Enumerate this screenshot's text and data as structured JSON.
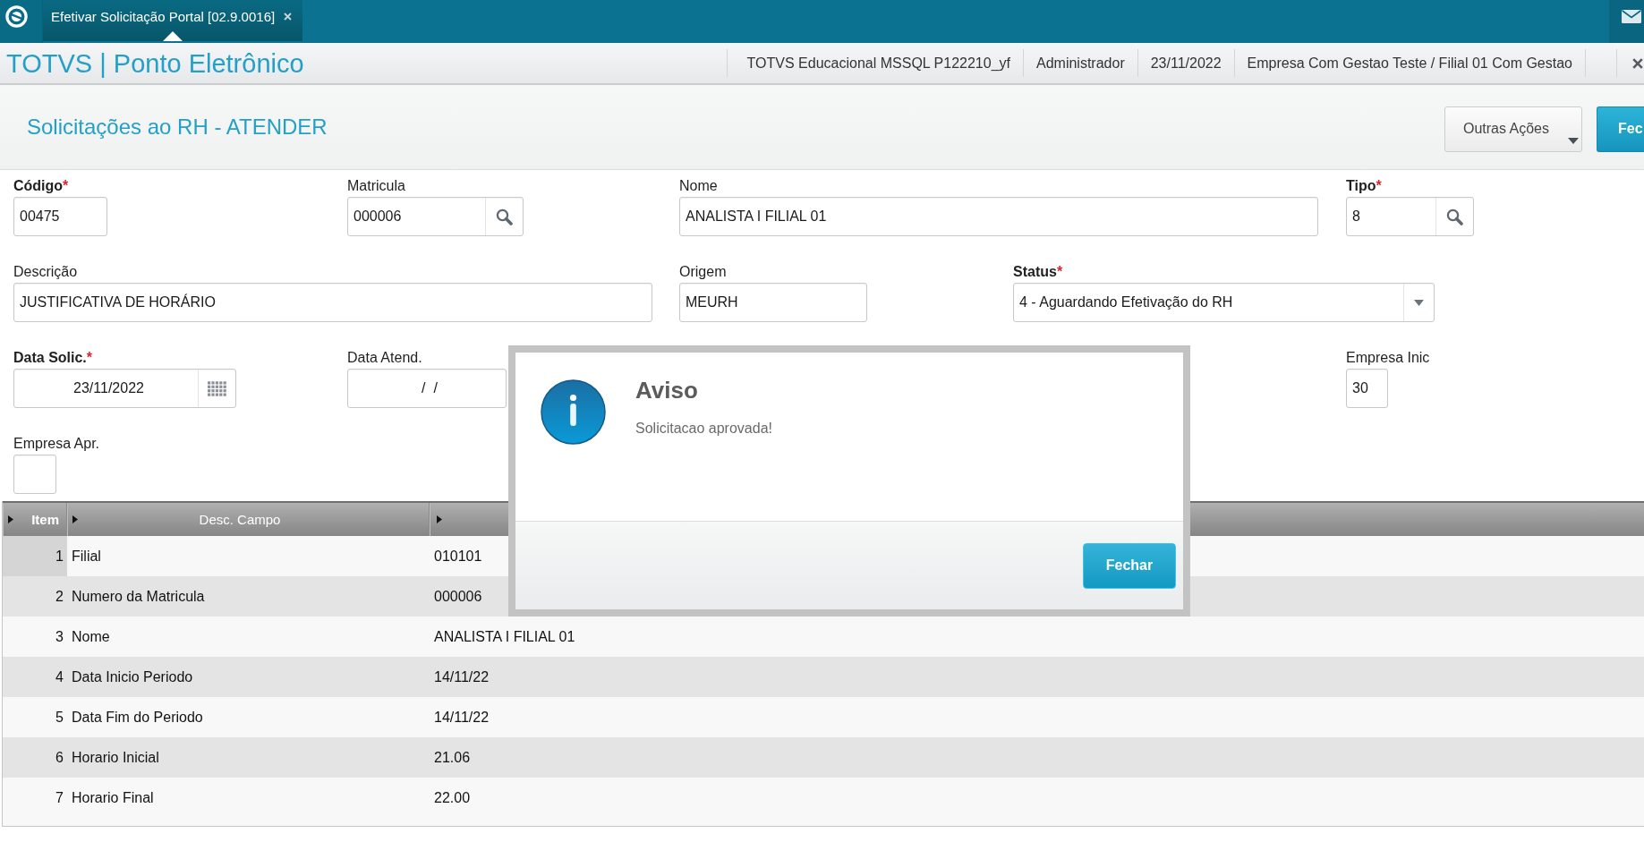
{
  "window": {
    "tabs": [
      {
        "label": "Efetivar Solicitação Portal [02.9.0016]",
        "selected": true
      }
    ]
  },
  "app_header": {
    "title": "TOTVS | Ponto Eletrônico",
    "info": [
      "TOTVS Educacional MSSQL P122210_yf",
      "Administrador",
      "23/11/2022",
      "Empresa Com Gestao Teste / Filial 01 Com Gestao"
    ]
  },
  "page": {
    "title": "Solicitações ao RH - ATENDER",
    "actions": [
      {
        "label": "Outras Ações",
        "kind": "menu"
      },
      {
        "label": "Fec",
        "kind": "primary"
      }
    ]
  },
  "form": {
    "fields": [
      {
        "label": "Código",
        "required": true,
        "required_mark": "*",
        "kind": "text",
        "value": "00475"
      },
      {
        "label": "Matricula",
        "required": false,
        "kind": "lookup",
        "value": "000006"
      },
      {
        "label": "Nome",
        "required": false,
        "kind": "text",
        "value": "ANALISTA I FILIAL 01"
      },
      {
        "label": "Tipo",
        "required": true,
        "required_mark": "*",
        "kind": "lookup",
        "value": "8"
      },
      {
        "label": "Descrição",
        "required": false,
        "kind": "text",
        "value": "JUSTIFICATIVA DE HORÁRIO"
      },
      {
        "label": "Origem",
        "required": false,
        "kind": "text",
        "value": "MEURH"
      },
      {
        "label": "Status",
        "required": true,
        "required_mark": "*",
        "kind": "select",
        "value": "4 - Aguardando Efetivação do RH"
      },
      {
        "label": "Data Solic.",
        "required": true,
        "required_mark": "*",
        "kind": "date",
        "value": "23/11/2022"
      },
      {
        "label": "Data Atend.",
        "required": false,
        "kind": "masked",
        "value": "/  /"
      },
      {
        "label": "Empresa Inic",
        "required": false,
        "kind": "text",
        "value": "30"
      },
      {
        "label": "Empresa Apr.",
        "required": false,
        "kind": "text"
      }
    ]
  },
  "grid": {
    "columns": [
      "Item",
      "Desc. Campo"
    ],
    "rows": [
      {
        "item": "1",
        "desc": "Filial",
        "column_3": "010101",
        "selected": true
      },
      {
        "item": "2",
        "desc": "Numero da Matricula",
        "column_3": "000006",
        "selected": false
      },
      {
        "item": "3",
        "desc": "Nome",
        "column_3": "ANALISTA I FILIAL 01",
        "selected": false
      },
      {
        "item": "4",
        "desc": "Data Inicio Periodo",
        "column_3": "14/11/22",
        "selected": false
      },
      {
        "item": "5",
        "desc": "Data Fim do Periodo",
        "column_3": "14/11/22",
        "selected": false
      },
      {
        "item": "6",
        "desc": "Horario Inicial",
        "column_3": "21.06",
        "selected": false
      },
      {
        "item": "7",
        "desc": "Horario Final",
        "column_3": "22.00",
        "selected": false
      }
    ]
  },
  "dialog": {
    "title": "Aviso",
    "message": "Solicitacao aprovada!",
    "button": "Fechar"
  }
}
